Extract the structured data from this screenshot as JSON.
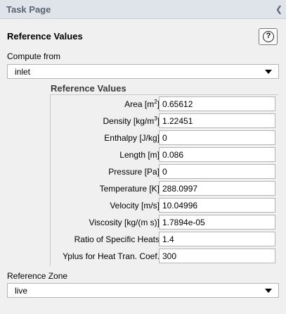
{
  "window": {
    "title": "Task Page",
    "collapse_icon": "chevron-left-icon"
  },
  "panel": {
    "heading": "Reference Values",
    "help_icon": "question-mark-icon",
    "help_label": "?"
  },
  "compute_from": {
    "label": "Compute from",
    "value": "inlet"
  },
  "reference_values": {
    "title": "Reference Values",
    "rows": [
      {
        "label": "Area",
        "unit_prefix": " [m",
        "unit_sup": "2",
        "unit_suffix": "]",
        "value": "0.65612"
      },
      {
        "label": "Density",
        "unit_prefix": " [kg/m",
        "unit_sup": "3",
        "unit_suffix": "]",
        "value": "1.22451"
      },
      {
        "label": "Enthalpy [J/kg]",
        "value": "0"
      },
      {
        "label": "Length [m]",
        "value": "0.086"
      },
      {
        "label": "Pressure [Pa]",
        "value": "0"
      },
      {
        "label": "Temperature [K]",
        "value": "288.0997"
      },
      {
        "label": "Velocity [m/s]",
        "value": "10.04996"
      },
      {
        "label": "Viscosity [kg/(m s)]",
        "value": "1.7894e-05"
      },
      {
        "label": "Ratio of Specific Heats",
        "value": "1.4"
      },
      {
        "label": "Yplus for Heat Tran. Coef.",
        "value": "300"
      }
    ]
  },
  "reference_zone": {
    "label": "Reference Zone",
    "value": "live"
  }
}
